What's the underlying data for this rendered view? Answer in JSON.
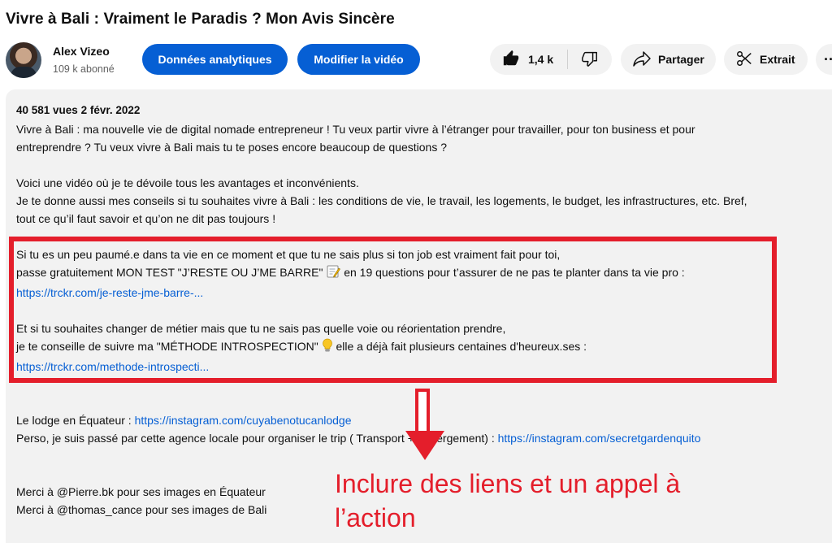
{
  "video": {
    "title": "Vivre à Bali : Vraiment le Paradis ? Mon Avis Sincère"
  },
  "channel": {
    "name": "Alex Vizeo",
    "subscribers": "109 k abonné"
  },
  "actions": {
    "analytics_label": "Données analytiques",
    "edit_label": "Modifier la vidéo",
    "like_count": "1,4 k",
    "share_label": "Partager",
    "clip_label": "Extrait",
    "more_label": "···"
  },
  "description": {
    "stats": "40 581 vues  2 févr. 2022",
    "p1_l1": "Vivre à Bali : ma nouvelle vie de digital nomade entrepreneur ! Tu veux partir vivre à l’étranger pour travailler, pour ton business et pour",
    "p1_l2": "entreprendre ? Tu veux vivre à Bali mais tu te poses encore beaucoup de questions ?",
    "p2_l1": "Voici une vidéo où je te dévoile tous les avantages et inconvénients.",
    "p2_l2": "Je te donne aussi mes conseils si tu souhaites vivre à Bali : les conditions de vie, le travail, les logements, le budget, les infrastructures, etc. Bref,",
    "p2_l3": "tout ce qu’il faut savoir et qu’on ne dit pas toujours !",
    "p3_l1": "Si tu es un peu paumé.e dans ta vie en ce moment et que tu ne sais plus si ton job est vraiment fait pour toi,",
    "p3_l2a": "passe gratuitement MON TEST \"J’RESTE OU J’ME BARRE\"",
    "p3_l2b": "en 19 questions pour t’assurer de ne pas te planter dans ta vie pro :",
    "p3_link": "https://trckr.com/je-reste-jme-barre-...",
    "p4_l1": "Et si tu souhaites changer de métier mais que tu ne sais pas quelle voie ou réorientation prendre,",
    "p4_l2a": "je te conseille de suivre ma \"MÉTHODE INTROSPECTION\"",
    "p4_l2b": "elle a déjà fait plusieurs centaines d'heureux.ses :",
    "p4_link": "https://trckr.com/methode-introspecti...",
    "p5_l1a": "Le lodge en Équateur : ",
    "p5_l1_link": "https://instagram.com/cuyabenotucanlodge",
    "p5_l2a": "Perso, je suis passé par cette agence locale pour organiser le trip ( Transport + hébergement) : ",
    "p5_l2_link": "https://instagram.com/secretgardenquito",
    "p6_l1": "Merci à @Pierre.bk pour ses images en Équateur",
    "p6_l2": "Merci à @thomas_cance pour ses images de Bali"
  },
  "annotation": {
    "callout": "Inclure des liens et un appel à l’action",
    "color": "#e41e2b"
  },
  "colors": {
    "brand_blue": "#065fd4",
    "pill_bg": "#f2f2f2"
  }
}
